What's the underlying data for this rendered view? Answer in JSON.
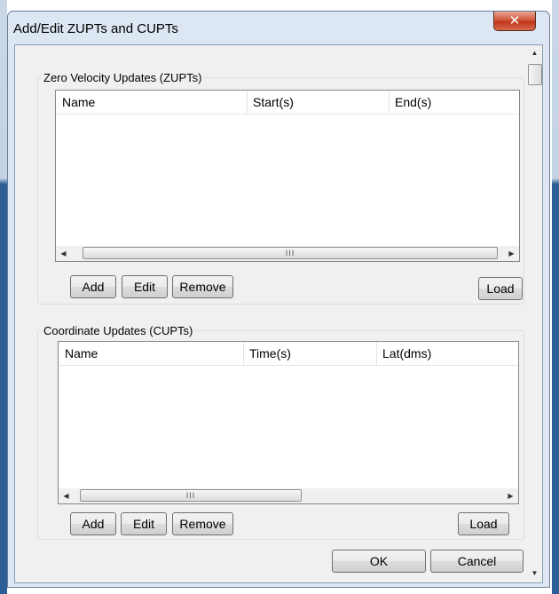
{
  "window": {
    "title": "Add/Edit ZUPTs and CUPTs",
    "close_glyph": "✕"
  },
  "zupt": {
    "group_label": "Zero Velocity Updates (ZUPTs)",
    "columns": [
      "Name",
      "Start(s)",
      "End(s)"
    ],
    "rows": [],
    "buttons": {
      "add": "Add",
      "edit": "Edit",
      "remove": "Remove",
      "load": "Load"
    }
  },
  "cupt": {
    "group_label": "Coordinate Updates (CUPTs)",
    "columns": [
      "Name",
      "Time(s)",
      "Lat(dms)"
    ],
    "rows": [],
    "buttons": {
      "add": "Add",
      "edit": "Edit",
      "remove": "Remove",
      "load": "Load"
    }
  },
  "footer": {
    "ok": "OK",
    "cancel": "Cancel"
  },
  "icons": {
    "close": "close-icon",
    "scroll_up": "up-arrow-icon",
    "scroll_down": "down-arrow-icon",
    "scroll_left": "left-arrow-icon",
    "scroll_right": "right-arrow-icon"
  },
  "colors": {
    "close_button": "#c0361b",
    "frame": "#dce7f3",
    "client": "#f0f0f0"
  }
}
